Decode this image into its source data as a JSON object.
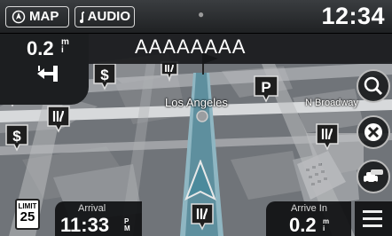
{
  "top_bar": {
    "map_label": "MAP",
    "audio_label": "AUDIO",
    "clock": "12:34"
  },
  "guidance": {
    "street_name": "AAAAAAAA",
    "turn_distance": "0.2",
    "turn_distance_unit": "m\ni"
  },
  "map_labels": {
    "city": "Los Angeles",
    "street": "N Broadway"
  },
  "bottom_bar": {
    "speed_limit_label": "LIMIT",
    "speed_limit_value": "25",
    "arrival_label": "Arrival",
    "arrival_time": "11:33",
    "arrival_ampm": "P\nM",
    "arrive_in_label": "Arrive In",
    "arrive_in_value": "0.2",
    "arrive_in_unit": "m\ni"
  },
  "icons": [
    "compass-icon",
    "music-note-icon",
    "turn-left-arrow-icon",
    "search-icon",
    "cancel-route-icon",
    "traffic-cars-icon",
    "menu-icon",
    "parking-icon",
    "restaurant-icon",
    "dollar-icon",
    "vehicle-position-icon"
  ],
  "colors": {
    "bar": "#1c1e20",
    "route": "#5a8a98",
    "map": "#6e7378",
    "buildings": "#8a8d91"
  }
}
